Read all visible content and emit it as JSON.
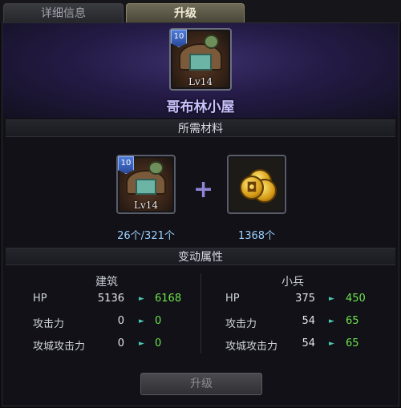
{
  "tabs": [
    {
      "label": "详细信息",
      "active": false
    },
    {
      "label": "升级",
      "active": true
    }
  ],
  "building": {
    "name": "哥布林小屋",
    "level_badge": "10",
    "level_text": "Lv14",
    "icon": "goblin-hut-icon"
  },
  "materials": {
    "title": "所需材料",
    "items": [
      {
        "icon": "goblin-hut-icon",
        "level_badge": "10",
        "level_text": "Lv14",
        "count": "26个/321个"
      },
      {
        "icon": "gold-coins-icon",
        "count": "1368个"
      }
    ],
    "plus_symbol": "+"
  },
  "stats": {
    "title": "变动属性",
    "columns": [
      {
        "title": "建筑",
        "rows": [
          {
            "label": "HP",
            "old": "5136",
            "new": "6168"
          },
          {
            "label": "攻击力",
            "old": "0",
            "new": "0"
          },
          {
            "label": "攻城攻击力",
            "old": "0",
            "new": "0"
          }
        ]
      },
      {
        "title": "小兵",
        "rows": [
          {
            "label": "HP",
            "old": "375",
            "new": "450"
          },
          {
            "label": "攻击力",
            "old": "54",
            "new": "65"
          },
          {
            "label": "攻城攻击力",
            "old": "54",
            "new": "65"
          }
        ]
      }
    ],
    "arrow_symbol": "►"
  },
  "upgrade_button": {
    "label": "升级",
    "enabled": false
  },
  "colors": {
    "new_value": "#6ee44c",
    "count_text": "#9bd0ff",
    "building_name": "#c9c2ff",
    "banner_purple": "#3b2f6b"
  }
}
